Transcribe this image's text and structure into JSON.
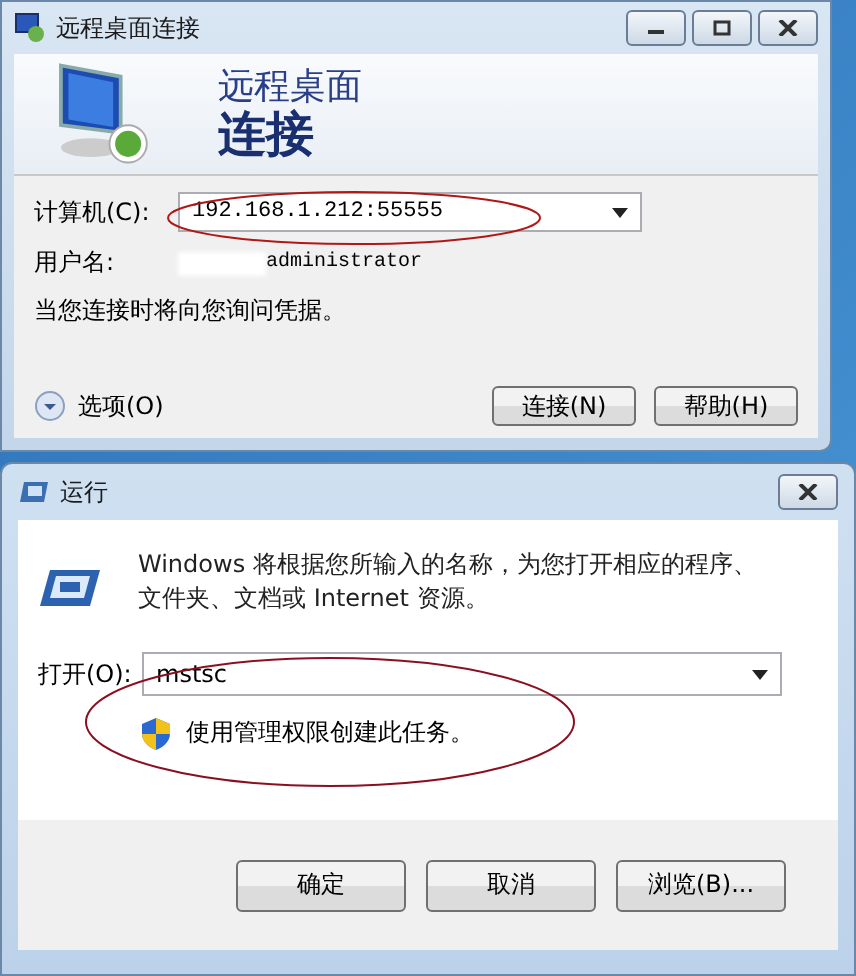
{
  "rdp_window": {
    "title": "远程桌面连接",
    "banner": {
      "line1": "远程桌面",
      "line2": "连接"
    },
    "computer": {
      "label": "计算机(C):",
      "value": "192.168.1.212:55555"
    },
    "username": {
      "label": "用户名:",
      "value": "administrator"
    },
    "notice": "当您连接时将向您询问凭据。",
    "options_toggle": "选项(O)",
    "buttons": [
      "连接(N)",
      "帮助(H)"
    ]
  },
  "run_window": {
    "title": "运行",
    "description": "Windows 将根据您所输入的名称，为您打开相应的程序、文件夹、文档或 Internet 资源。",
    "open": {
      "label": "打开(O):",
      "value": "mstsc"
    },
    "admin_note": "使用管理权限创建此任务。",
    "buttons": [
      "确定",
      "取消",
      "浏览(B)..."
    ]
  }
}
